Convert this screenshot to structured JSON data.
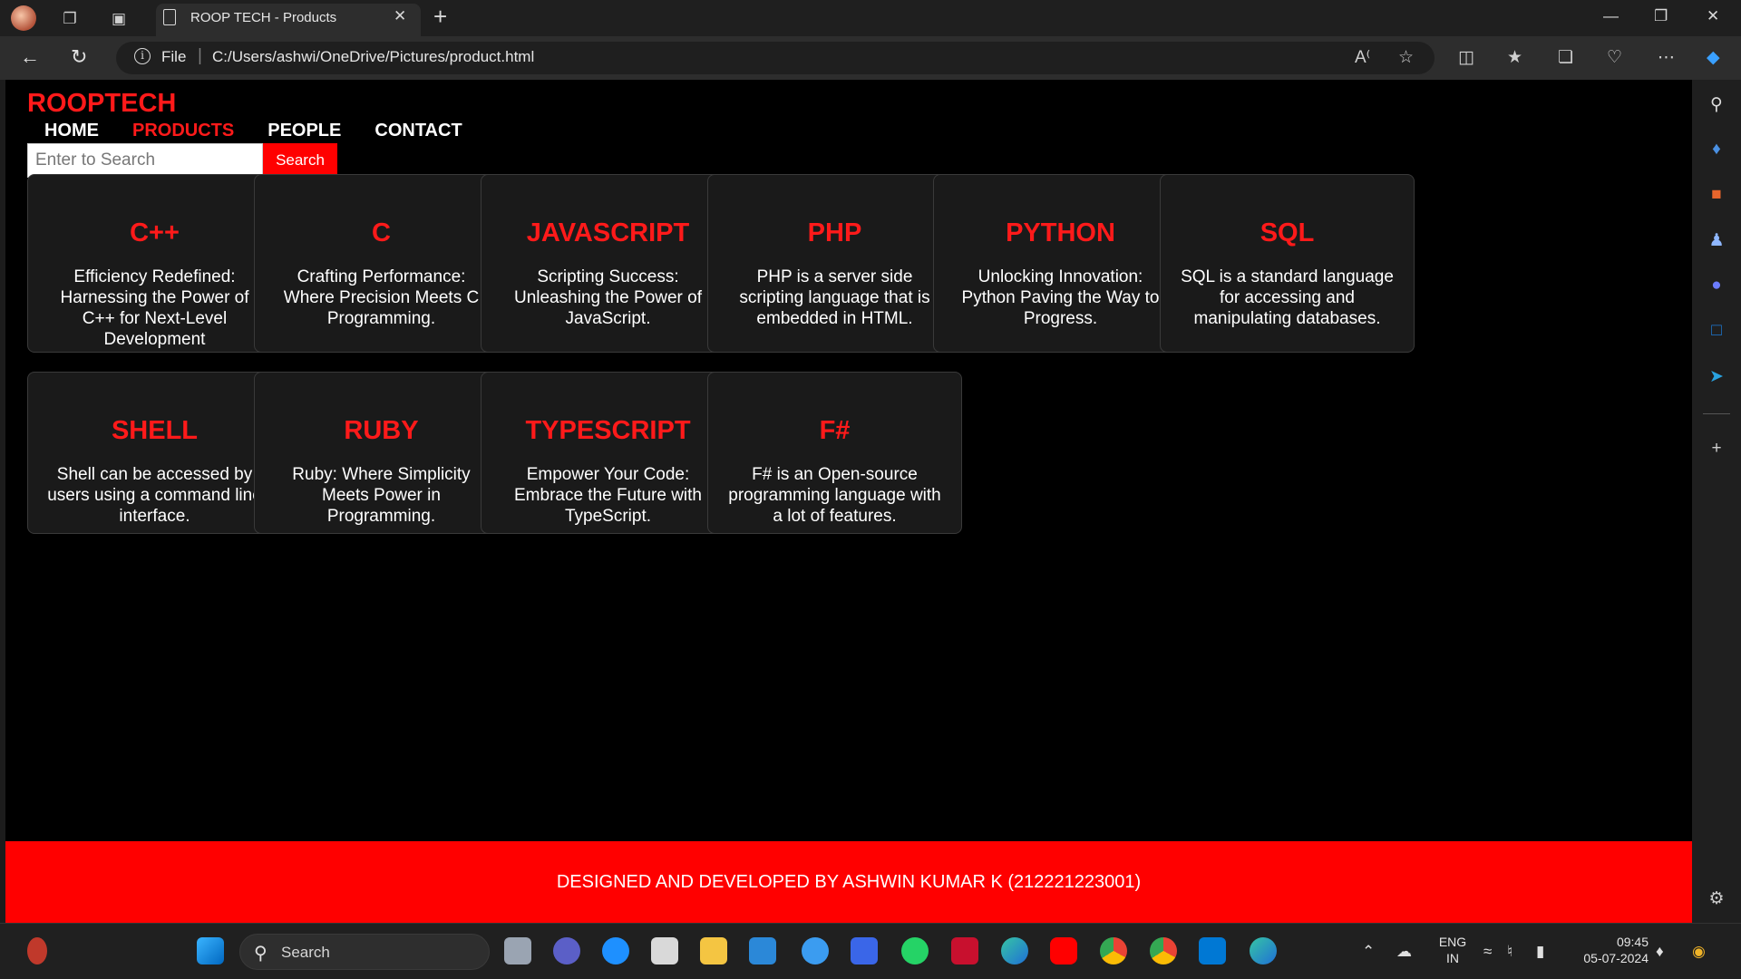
{
  "browser": {
    "tab_title": "ROOP TECH - Products",
    "url_scheme_label": "File",
    "url": "C:/Users/ashwi/OneDrive/Pictures/product.html"
  },
  "page": {
    "brand": "ROOPTECH",
    "nav": [
      "HOME",
      "PRODUCTS",
      "PEOPLE",
      "CONTACT"
    ],
    "active_nav": "PRODUCTS",
    "search_placeholder": "Enter to Search",
    "search_button": "Search",
    "cards": [
      {
        "title": "C++",
        "desc": "Efficiency Redefined: Harnessing the Power of C++ for Next-Level Development"
      },
      {
        "title": "C",
        "desc": "Crafting Performance: Where Precision Meets C Programming."
      },
      {
        "title": "JAVASCRIPT",
        "desc": "Scripting Success: Unleashing the Power of JavaScript."
      },
      {
        "title": "PHP",
        "desc": "PHP is a server side scripting language that is embedded in HTML."
      },
      {
        "title": "PYTHON",
        "desc": "Unlocking Innovation: Python Paving the Way to Progress."
      },
      {
        "title": "SQL",
        "desc": "SQL is a standard language for accessing and manipulating databases."
      },
      {
        "title": "SHELL",
        "desc": "Shell can be accessed by users using a command line interface."
      },
      {
        "title": "RUBY",
        "desc": "Ruby: Where Simplicity Meets Power in Programming."
      },
      {
        "title": "TYPESCRIPT",
        "desc": "Empower Your Code: Embrace the Future with TypeScript."
      },
      {
        "title": "F#",
        "desc": "F# is an Open-source programming language with a lot of features."
      }
    ],
    "footer": "DESIGNED AND DEVELOPED BY ASHWIN KUMAR K (212221223001)"
  },
  "taskbar": {
    "search_label": "Search",
    "language": "ENG",
    "region": "IN",
    "time": "09:45",
    "date": "05-07-2024"
  },
  "colors": {
    "accent_red": "#ff0000",
    "page_bg": "#000000",
    "card_bg": "#1a1a1a"
  }
}
